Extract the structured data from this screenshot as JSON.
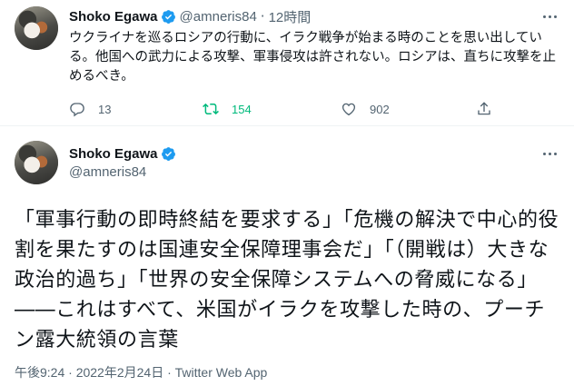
{
  "tweet_small": {
    "author_name": "Shoko Egawa",
    "handle": "@amneris84",
    "separator": "·",
    "time": "12時間",
    "text": "ウクライナを巡るロシアの行動に、イラク戦争が始まる時のことを思い出している。他国への武力による攻撃、軍事侵攻は許されない。ロシアは、直ちに攻撃を止めるべき。",
    "reply_count": "13",
    "retweet_count": "154",
    "like_count": "902",
    "icons": [
      "more-icon",
      "reply-icon",
      "retweet-icon",
      "like-icon",
      "share-icon",
      "verified-badge-icon"
    ]
  },
  "tweet_main": {
    "author_name": "Shoko Egawa",
    "handle": "@amneris84",
    "text": "「軍事行動の即時終結を要求する」「危機の解決で中心的役割を果たすのは国連安全保障理事会だ」「（開戦は）大きな政治的過ち」「世界の安全保障システムへの脅威になる」――これはすべて、米国がイラクを攻撃した時の、プーチン露大統領の言葉",
    "timestamp": "午後9:24 · 2022年2月24日",
    "separator": " · ",
    "source": "Twitter Web App"
  },
  "colors": {
    "verified_blue": "#1d9bf0",
    "retweet_green": "#00ba7c",
    "secondary_text": "#536471",
    "primary_text": "#0f1419"
  }
}
